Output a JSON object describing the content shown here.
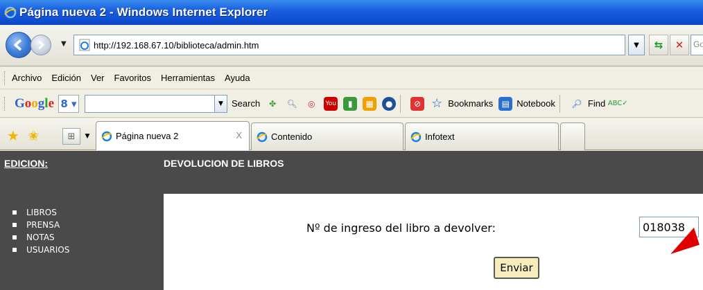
{
  "window": {
    "title": "Página nueva 2 - Windows Internet Explorer"
  },
  "address": {
    "url": "http://192.168.67.10/biblioteca/admin.htm",
    "search_placeholder": "Goo"
  },
  "menu": [
    "Archivo",
    "Edición",
    "Ver",
    "Favoritos",
    "Herramientas",
    "Ayuda"
  ],
  "google_toolbar": {
    "logo": [
      "G",
      "o",
      "o",
      "g",
      "l",
      "e"
    ],
    "search_label": "Search",
    "bookmarks_label": "Bookmarks",
    "notebook_label": "Notebook",
    "find_label": "Find"
  },
  "tabs": [
    {
      "label": "Página nueva 2",
      "active": true
    },
    {
      "label": "Contenido",
      "active": false
    },
    {
      "label": "Infotext",
      "active": false
    }
  ],
  "page": {
    "sidebar_heading": "EDICION:",
    "sidebar_items": [
      "LIBROS",
      "PRENSA",
      "NOTAS",
      "USUARIOS"
    ],
    "section_title": "DEVOLUCION DE LIBROS",
    "form_label": "Nº de ingreso del libro a devolver:",
    "form_value": "018038",
    "submit_label": "Enviar"
  },
  "colors": {
    "titlebar": "#0a47c9",
    "sidebar": "#4a4a4a",
    "annotation_arrow": "#e00000",
    "submit_bg": "#f7ecbc"
  }
}
